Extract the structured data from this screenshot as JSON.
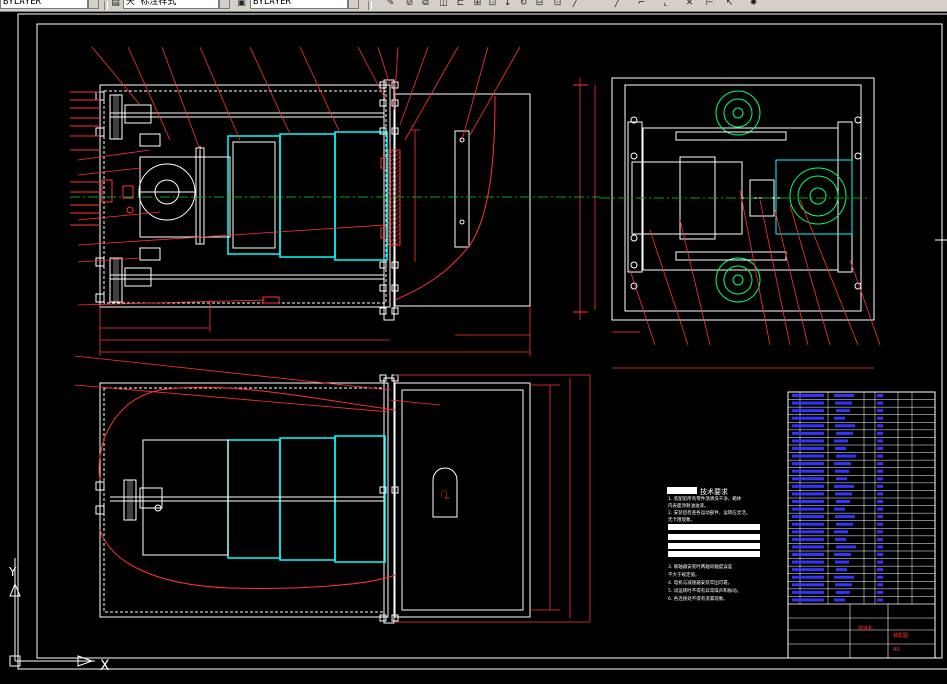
{
  "toolbar": {
    "layer_value": "BYLAYER",
    "style_value": "天 标注样式",
    "color_value": "BYLAYER",
    "icons": [
      "drop-icon",
      "layer-icon",
      "color-icon",
      "pencil-icon",
      "match-prop-icon",
      "copy-icon",
      "mirror-icon",
      "offset-icon",
      "move-icon",
      "rotate-icon",
      "scale-icon",
      "stretch-icon",
      "trim-icon",
      "line-icon",
      "arc-icon",
      "pan-icon",
      "explode-icon"
    ]
  },
  "drawing": {
    "tech_title": "技术要求",
    "tech_notes": [
      "1. 装配前所有零件须清洗干净，箱体",
      "   内表面涂耐油油漆。",
      "2. 安装后检查各运动部件，运转应灵活，",
      "   无卡阻现象。",
      "3. 联轴器安装时两轴同轴度误差",
      "   不大于规定值。",
      "4. 电机与减速器安装牢固可靠。",
      "5. 试运转时不得有异常噪声和振动。",
      "6. 各连接处不得有渗漏现象。"
    ],
    "door_label": "门",
    "title_block": {
      "name": "搅拌机",
      "drawing_no": "装配图",
      "sheet": "A0"
    },
    "ucs_x": "X",
    "ucs_y": "Y"
  },
  "colors": {
    "outer_frame": "#ffffff",
    "parts": "#ffffff",
    "drums": "#00ffff",
    "leaders": "#ff0000",
    "center": "#00aa00",
    "green_parts": "#00ff66",
    "table_text": "#3333ff"
  }
}
